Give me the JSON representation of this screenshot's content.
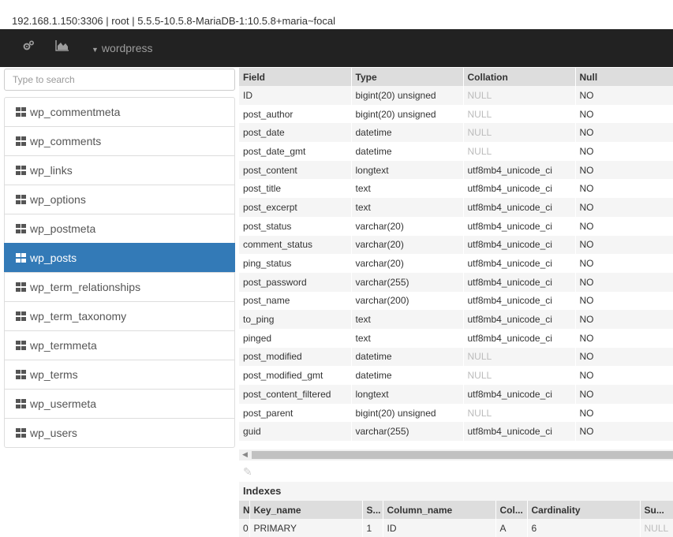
{
  "connection": "192.168.1.150:3306 | root | 5.5.5-10.5.8-MariaDB-1:10.5.8+maria~focal",
  "navbar": {
    "database": "wordpress",
    "icons": [
      "cogs-icon",
      "area-chart-icon"
    ]
  },
  "search": {
    "placeholder": "Type to search",
    "value": ""
  },
  "sidebar": {
    "items": [
      {
        "label": "wp_commentmeta"
      },
      {
        "label": "wp_comments"
      },
      {
        "label": "wp_links"
      },
      {
        "label": "wp_options"
      },
      {
        "label": "wp_postmeta"
      },
      {
        "label": "wp_posts",
        "active": true
      },
      {
        "label": "wp_term_relationships"
      },
      {
        "label": "wp_term_taxonomy"
      },
      {
        "label": "wp_termmeta"
      },
      {
        "label": "wp_terms"
      },
      {
        "label": "wp_usermeta"
      },
      {
        "label": "wp_users"
      }
    ]
  },
  "structure": {
    "headers": [
      "Field",
      "Type",
      "Collation",
      "Null"
    ],
    "rows": [
      [
        "ID",
        "bigint(20) unsigned",
        "NULL",
        "NO"
      ],
      [
        "post_author",
        "bigint(20) unsigned",
        "NULL",
        "NO"
      ],
      [
        "post_date",
        "datetime",
        "NULL",
        "NO"
      ],
      [
        "post_date_gmt",
        "datetime",
        "NULL",
        "NO"
      ],
      [
        "post_content",
        "longtext",
        "utf8mb4_unicode_ci",
        "NO"
      ],
      [
        "post_title",
        "text",
        "utf8mb4_unicode_ci",
        "NO"
      ],
      [
        "post_excerpt",
        "text",
        "utf8mb4_unicode_ci",
        "NO"
      ],
      [
        "post_status",
        "varchar(20)",
        "utf8mb4_unicode_ci",
        "NO"
      ],
      [
        "comment_status",
        "varchar(20)",
        "utf8mb4_unicode_ci",
        "NO"
      ],
      [
        "ping_status",
        "varchar(20)",
        "utf8mb4_unicode_ci",
        "NO"
      ],
      [
        "post_password",
        "varchar(255)",
        "utf8mb4_unicode_ci",
        "NO"
      ],
      [
        "post_name",
        "varchar(200)",
        "utf8mb4_unicode_ci",
        "NO"
      ],
      [
        "to_ping",
        "text",
        "utf8mb4_unicode_ci",
        "NO"
      ],
      [
        "pinged",
        "text",
        "utf8mb4_unicode_ci",
        "NO"
      ],
      [
        "post_modified",
        "datetime",
        "NULL",
        "NO"
      ],
      [
        "post_modified_gmt",
        "datetime",
        "NULL",
        "NO"
      ],
      [
        "post_content_filtered",
        "longtext",
        "utf8mb4_unicode_ci",
        "NO"
      ],
      [
        "post_parent",
        "bigint(20) unsigned",
        "NULL",
        "NO"
      ],
      [
        "guid",
        "varchar(255)",
        "utf8mb4_unicode_ci",
        "NO"
      ]
    ]
  },
  "indexes": {
    "title": "Indexes",
    "headers": [
      "N",
      "Key_name",
      "S...",
      "Column_name",
      "Col...",
      "Cardinality",
      "Su..."
    ],
    "rows": [
      [
        "0",
        "PRIMARY",
        "1",
        "ID",
        "A",
        "6",
        "NULL"
      ]
    ]
  },
  "colors": {
    "navbar": "#222222",
    "active": "#337ab7",
    "header_bg": "#dddddd",
    "null_text": "#bbbbbb"
  }
}
